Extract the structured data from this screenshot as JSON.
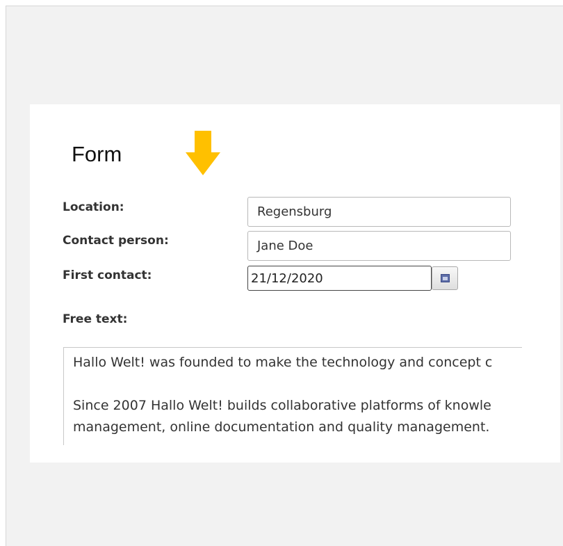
{
  "form": {
    "title": "Form",
    "location": {
      "label": "Location:",
      "value": "Regensburg"
    },
    "contact_person": {
      "label": "Contact person:",
      "value": "Jane Doe"
    },
    "first_contact": {
      "label": "First contact:",
      "value": "21/12/2020"
    },
    "free_text": {
      "label": "Free text:",
      "lines": [
        "Hallo Welt! was founded to make the technology and concept c",
        "",
        "Since 2007 Hallo Welt! builds collaborative platforms of knowle",
        "management, online documentation and quality management."
      ]
    }
  },
  "colors": {
    "arrow": "#ffc000",
    "panel_background": "#f2f2f2",
    "card_background": "#ffffff"
  },
  "icons": {
    "arrow": "arrow-down-icon",
    "calendar": "calendar-icon"
  }
}
